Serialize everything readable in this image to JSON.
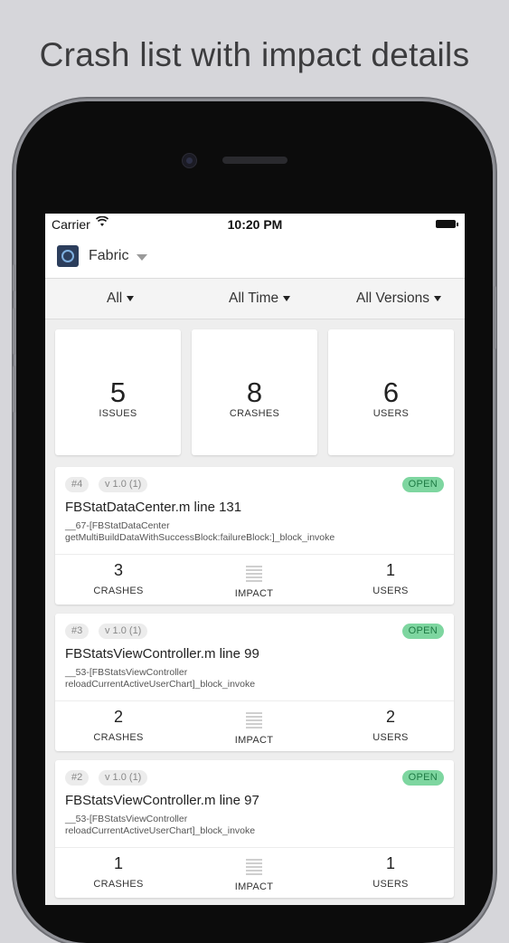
{
  "headline": "Crash list with impact details",
  "status_bar": {
    "carrier": "Carrier",
    "time": "10:20 PM",
    "wifi_icon": "wifi-icon",
    "battery_icon": "battery-icon"
  },
  "app_bar": {
    "app_name": "Fabric",
    "logo_icon": "fabric-logo",
    "dropdown_icon": "caret-down-icon"
  },
  "filters": [
    {
      "label": "All"
    },
    {
      "label": "All Time"
    },
    {
      "label": "All Versions"
    }
  ],
  "stats": [
    {
      "value": "5",
      "label": "ISSUES"
    },
    {
      "value": "8",
      "label": "CRASHES"
    },
    {
      "value": "6",
      "label": "USERS"
    }
  ],
  "issues": [
    {
      "number": "#4",
      "version": "v 1.0 (1)",
      "status": "OPEN",
      "title": "FBStatDataCenter.m line 131",
      "subtitle_line1": "__67-[FBStatDataCenter",
      "subtitle_line2": "getMultiBuildDataWithSuccessBlock:failureBlock:]_block_invoke",
      "crashes": "3",
      "crashes_label": "CRASHES",
      "impact_label": "IMPACT",
      "users": "1",
      "users_label": "USERS"
    },
    {
      "number": "#3",
      "version": "v 1.0 (1)",
      "status": "OPEN",
      "title": "FBStatsViewController.m line 99",
      "subtitle_line1": "__53-[FBStatsViewController",
      "subtitle_line2": "reloadCurrentActiveUserChart]_block_invoke",
      "crashes": "2",
      "crashes_label": "CRASHES",
      "impact_label": "IMPACT",
      "users": "2",
      "users_label": "USERS"
    },
    {
      "number": "#2",
      "version": "v 1.0 (1)",
      "status": "OPEN",
      "title": "FBStatsViewController.m line 97",
      "subtitle_line1": "__53-[FBStatsViewController",
      "subtitle_line2": "reloadCurrentActiveUserChart]_block_invoke",
      "crashes": "1",
      "crashes_label": "CRASHES",
      "impact_label": "IMPACT",
      "users": "1",
      "users_label": "USERS"
    }
  ],
  "colors": {
    "background": "#d6d6da",
    "open_badge": "#7ed6a0",
    "phone_body": "#0c0c0c"
  }
}
